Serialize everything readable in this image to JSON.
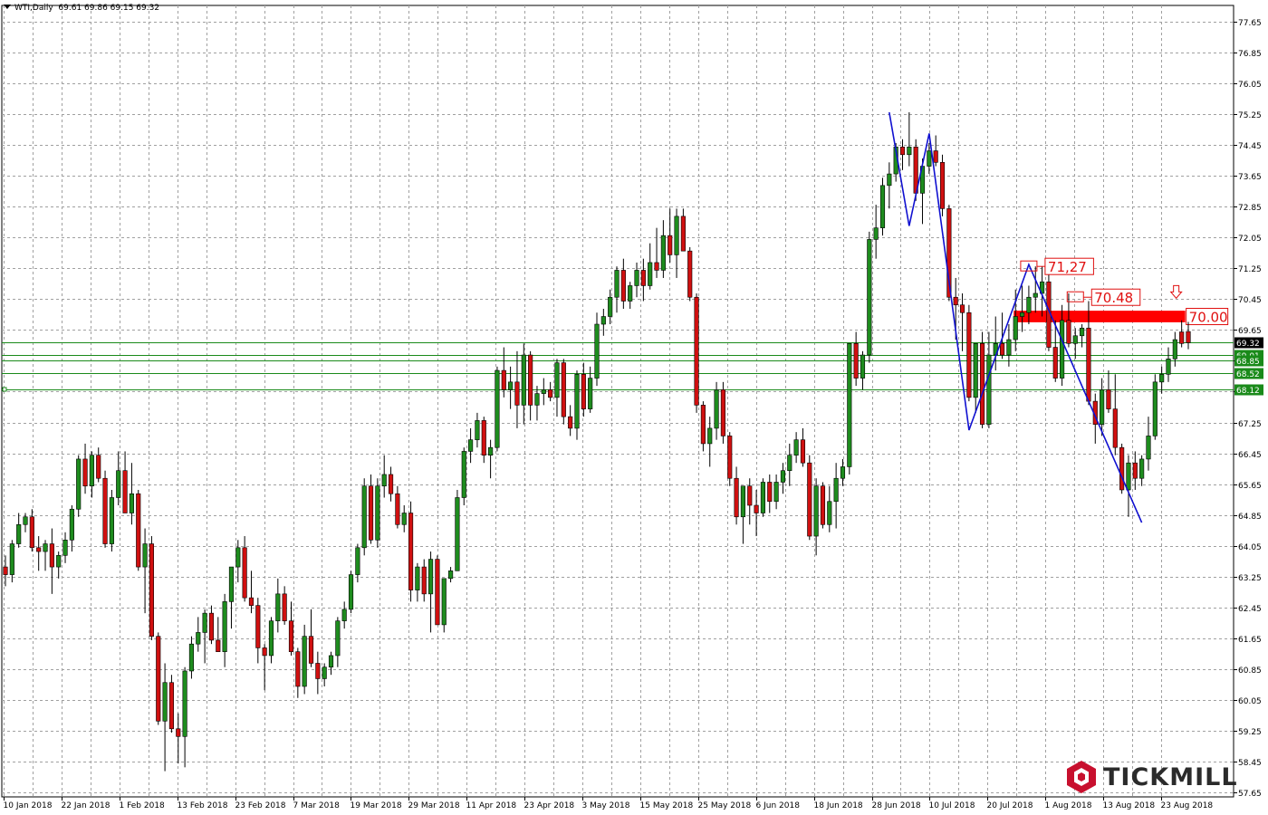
{
  "header": {
    "symbol": "WTI,Daily",
    "ohlc": "69.61 69.86 69.15 69.32"
  },
  "logo": {
    "text": "TICKMILL",
    "color": "#c8102e"
  },
  "colors": {
    "bull": "#1e8c1e",
    "bear": "#d01010",
    "grid": "#a0a0a0",
    "pattern": "#1010d0",
    "level": "#1a8a1a",
    "resistance": "#ff0000",
    "annotation": "#e01010"
  },
  "annotations": {
    "peak1": "71,27",
    "peak2": "70.48",
    "zone": "70.00"
  },
  "chart_data": {
    "type": "candlestick",
    "symbol": "WTI",
    "timeframe": "Daily",
    "ylim": [
      57.65,
      77.65
    ],
    "y_ticks": [
      "77.65",
      "76.85",
      "76.05",
      "75.25",
      "74.45",
      "73.65",
      "72.85",
      "72.05",
      "71.25",
      "70.45",
      "69.65",
      "68.85",
      "68.05",
      "67.25",
      "66.45",
      "65.65",
      "64.85",
      "64.05",
      "63.25",
      "62.45",
      "61.65",
      "60.85",
      "60.05",
      "59.25",
      "58.45",
      "57.65"
    ],
    "x_ticks": [
      "10 Jan 2018",
      "22 Jan 2018",
      "1 Feb 2018",
      "13 Feb 2018",
      "23 Feb 2018",
      "7 Mar 2018",
      "19 Mar 2018",
      "29 Mar 2018",
      "11 Apr 2018",
      "23 Apr 2018",
      "3 May 2018",
      "15 May 2018",
      "25 May 2018",
      "6 Jun 2018",
      "18 Jun 2018",
      "28 Jun 2018",
      "10 Jul 2018",
      "20 Jul 2018",
      "1 Aug 2018",
      "13 Aug 2018",
      "23 Aug 2018"
    ],
    "horizontal_levels": [
      {
        "value": 69.32,
        "label": "69.32",
        "kind": "price"
      },
      {
        "value": 69.01,
        "label": "69.01",
        "kind": "level"
      },
      {
        "value": 68.85,
        "label": "68.85",
        "kind": "level"
      },
      {
        "value": 68.52,
        "label": "68.52",
        "kind": "level"
      },
      {
        "value": 68.12,
        "label": "68.12",
        "kind": "level"
      }
    ],
    "resistance_zone": {
      "from": 69.85,
      "to": 70.15,
      "label": "70.00"
    },
    "pattern_points": [
      {
        "x": "28 Jun 2018",
        "y": 75.3
      },
      {
        "x": "3 Jul 2018",
        "y": 72.35
      },
      {
        "x": "6 Jul 2018",
        "y": 74.75
      },
      {
        "x": "16 Jul 2018",
        "y": 67.05
      },
      {
        "x": "27 Jul 2018",
        "y": 71.35
      },
      {
        "x": "16 Aug 2018",
        "y": 64.65
      }
    ],
    "candles": [
      [
        63.5,
        63.8,
        63.0,
        63.3
      ],
      [
        63.3,
        64.2,
        63.1,
        64.1
      ],
      [
        64.1,
        64.9,
        64.0,
        64.6
      ],
      [
        64.6,
        64.9,
        64.4,
        64.8
      ],
      [
        64.8,
        65.0,
        63.9,
        64.0
      ],
      [
        64.0,
        64.3,
        63.4,
        63.9
      ],
      [
        63.9,
        64.2,
        63.4,
        64.1
      ],
      [
        64.1,
        64.5,
        62.8,
        63.5
      ],
      [
        63.5,
        63.9,
        63.2,
        63.8
      ],
      [
        63.8,
        64.4,
        63.6,
        64.2
      ],
      [
        64.2,
        65.1,
        63.9,
        65.0
      ],
      [
        65.0,
        66.4,
        64.8,
        66.3
      ],
      [
        66.3,
        66.7,
        65.4,
        65.6
      ],
      [
        65.6,
        66.5,
        65.3,
        66.4
      ],
      [
        66.4,
        66.6,
        65.7,
        65.8
      ],
      [
        65.8,
        66.0,
        64.0,
        64.1
      ],
      [
        64.1,
        65.5,
        63.9,
        65.3
      ],
      [
        65.3,
        66.5,
        65.1,
        66.0
      ],
      [
        66.0,
        66.5,
        64.9,
        64.9
      ],
      [
        64.9,
        66.2,
        64.6,
        65.4
      ],
      [
        65.4,
        65.5,
        63.4,
        63.5
      ],
      [
        63.5,
        64.5,
        62.3,
        64.1
      ],
      [
        64.1,
        64.3,
        61.6,
        61.7
      ],
      [
        61.7,
        61.8,
        59.4,
        59.5
      ],
      [
        59.5,
        61.0,
        58.2,
        60.5
      ],
      [
        60.5,
        60.7,
        59.2,
        59.3
      ],
      [
        59.3,
        59.7,
        58.4,
        59.1
      ],
      [
        59.1,
        60.9,
        58.3,
        60.8
      ],
      [
        60.8,
        61.7,
        60.6,
        61.5
      ],
      [
        61.5,
        62.2,
        61.3,
        61.8
      ],
      [
        61.8,
        62.4,
        61.0,
        62.3
      ],
      [
        62.3,
        62.5,
        61.5,
        61.6
      ],
      [
        61.6,
        62.2,
        61.3,
        61.3
      ],
      [
        61.3,
        62.8,
        60.9,
        62.6
      ],
      [
        62.6,
        63.4,
        61.9,
        63.5
      ],
      [
        63.5,
        64.2,
        63.1,
        64.0
      ],
      [
        64.0,
        64.3,
        62.6,
        62.7
      ],
      [
        62.7,
        63.4,
        62.3,
        62.5
      ],
      [
        62.5,
        62.7,
        61.0,
        61.4
      ],
      [
        61.4,
        61.5,
        60.3,
        61.2
      ],
      [
        61.2,
        62.2,
        61.0,
        62.1
      ],
      [
        62.1,
        63.2,
        61.8,
        62.8
      ],
      [
        62.8,
        63.0,
        62.0,
        62.1
      ],
      [
        62.1,
        62.6,
        61.2,
        61.3
      ],
      [
        61.3,
        61.4,
        60.1,
        60.4
      ],
      [
        60.4,
        62.0,
        60.2,
        61.7
      ],
      [
        61.7,
        62.4,
        60.9,
        61.0
      ],
      [
        61.0,
        61.3,
        60.2,
        60.6
      ],
      [
        60.6,
        61.0,
        60.4,
        60.9
      ],
      [
        60.9,
        61.3,
        60.7,
        61.2
      ],
      [
        61.2,
        62.2,
        60.9,
        62.1
      ],
      [
        62.1,
        62.6,
        61.9,
        62.4
      ],
      [
        62.4,
        63.4,
        62.3,
        63.3
      ],
      [
        63.3,
        64.1,
        63.1,
        64.0
      ],
      [
        64.0,
        65.8,
        63.8,
        65.6
      ],
      [
        65.6,
        65.9,
        64.1,
        64.2
      ],
      [
        64.2,
        65.8,
        64.0,
        65.6
      ],
      [
        65.6,
        66.4,
        65.3,
        65.9
      ],
      [
        65.9,
        66.1,
        65.2,
        65.4
      ],
      [
        65.4,
        65.6,
        64.5,
        64.6
      ],
      [
        64.6,
        65.1,
        64.4,
        64.9
      ],
      [
        64.9,
        65.2,
        62.6,
        62.9
      ],
      [
        62.9,
        63.6,
        62.6,
        63.5
      ],
      [
        63.5,
        63.7,
        62.6,
        62.8
      ],
      [
        62.8,
        63.9,
        61.8,
        63.7
      ],
      [
        63.7,
        63.8,
        62.1,
        62.0
      ],
      [
        62.0,
        63.2,
        61.8,
        63.2
      ],
      [
        63.2,
        63.5,
        63.1,
        63.4
      ],
      [
        63.4,
        65.5,
        63.4,
        65.3
      ],
      [
        65.3,
        66.6,
        65.1,
        66.5
      ],
      [
        66.5,
        67.1,
        66.2,
        66.8
      ],
      [
        66.8,
        67.5,
        66.6,
        67.3
      ],
      [
        67.3,
        67.4,
        66.2,
        66.4
      ],
      [
        66.4,
        66.8,
        65.8,
        66.6
      ],
      [
        66.6,
        68.7,
        66.5,
        68.6
      ],
      [
        68.6,
        69.2,
        67.9,
        68.1
      ],
      [
        68.1,
        68.7,
        67.6,
        68.3
      ],
      [
        68.3,
        69.1,
        67.1,
        67.7
      ],
      [
        67.7,
        69.3,
        67.2,
        69.0
      ],
      [
        69.0,
        69.1,
        67.3,
        67.7
      ],
      [
        67.7,
        68.2,
        67.3,
        68.0
      ],
      [
        68.0,
        68.4,
        67.7,
        68.1
      ],
      [
        68.1,
        68.3,
        67.8,
        67.9
      ],
      [
        67.9,
        68.9,
        67.4,
        68.8
      ],
      [
        68.8,
        68.9,
        67.2,
        67.4
      ],
      [
        67.4,
        67.7,
        66.9,
        67.1
      ],
      [
        67.1,
        68.6,
        66.8,
        68.5
      ],
      [
        68.5,
        68.8,
        67.4,
        67.6
      ],
      [
        67.6,
        68.7,
        67.5,
        68.4
      ],
      [
        68.4,
        70.1,
        68.2,
        69.8
      ],
      [
        69.8,
        70.2,
        69.5,
        70.0
      ],
      [
        70.0,
        70.7,
        69.8,
        70.5
      ],
      [
        70.5,
        71.3,
        70.1,
        71.2
      ],
      [
        71.2,
        71.5,
        70.2,
        70.4
      ],
      [
        70.4,
        70.9,
        70.2,
        70.8
      ],
      [
        70.8,
        71.4,
        70.5,
        71.2
      ],
      [
        71.2,
        71.5,
        70.4,
        70.8
      ],
      [
        70.8,
        71.9,
        70.7,
        71.4
      ],
      [
        71.4,
        72.3,
        71.0,
        71.2
      ],
      [
        71.2,
        72.5,
        71.0,
        72.1
      ],
      [
        72.1,
        72.8,
        71.4,
        71.6
      ],
      [
        71.6,
        72.8,
        71.0,
        72.6
      ],
      [
        72.6,
        72.8,
        71.7,
        71.7
      ],
      [
        71.7,
        71.8,
        70.4,
        70.5
      ],
      [
        70.5,
        70.6,
        67.5,
        67.7
      ],
      [
        67.7,
        67.8,
        66.5,
        66.7
      ],
      [
        66.7,
        67.4,
        66.1,
        67.1
      ],
      [
        67.1,
        68.3,
        66.8,
        68.1
      ],
      [
        68.1,
        68.3,
        66.7,
        66.9
      ],
      [
        66.9,
        67.0,
        65.6,
        65.8
      ],
      [
        65.8,
        66.1,
        64.6,
        64.8
      ],
      [
        64.8,
        65.6,
        64.1,
        65.6
      ],
      [
        65.6,
        65.8,
        64.6,
        65.1
      ],
      [
        65.1,
        65.5,
        64.3,
        64.9
      ],
      [
        64.9,
        65.8,
        64.8,
        65.7
      ],
      [
        65.7,
        65.9,
        64.9,
        65.2
      ],
      [
        65.2,
        65.9,
        65.0,
        65.7
      ],
      [
        65.7,
        66.2,
        65.4,
        66.0
      ],
      [
        66.0,
        66.7,
        65.6,
        66.4
      ],
      [
        66.4,
        67.0,
        66.2,
        66.8
      ],
      [
        66.8,
        67.1,
        66.1,
        66.2
      ],
      [
        66.2,
        66.4,
        64.2,
        64.3
      ],
      [
        64.3,
        65.8,
        63.8,
        65.6
      ],
      [
        65.6,
        65.7,
        64.5,
        64.6
      ],
      [
        64.6,
        65.6,
        64.4,
        65.2
      ],
      [
        65.2,
        66.2,
        64.5,
        65.8
      ],
      [
        65.8,
        66.3,
        65.6,
        66.1
      ],
      [
        66.1,
        69.3,
        65.9,
        69.3
      ],
      [
        69.3,
        69.6,
        68.2,
        68.4
      ],
      [
        68.4,
        69.1,
        68.1,
        69.0
      ],
      [
        69.0,
        72.2,
        68.8,
        72.0
      ],
      [
        72.0,
        72.9,
        71.5,
        72.3
      ],
      [
        72.3,
        73.6,
        72.1,
        73.4
      ],
      [
        73.4,
        74.0,
        72.8,
        73.7
      ],
      [
        73.7,
        74.5,
        73.5,
        74.4
      ],
      [
        74.4,
        74.6,
        73.8,
        74.2
      ],
      [
        74.2,
        75.3,
        73.9,
        74.4
      ],
      [
        74.4,
        74.6,
        73.0,
        73.2
      ],
      [
        73.2,
        74.1,
        72.4,
        73.9
      ],
      [
        73.9,
        74.5,
        73.7,
        74.3
      ],
      [
        74.3,
        74.7,
        73.9,
        74.0
      ],
      [
        74.0,
        74.2,
        72.6,
        72.8
      ],
      [
        72.8,
        72.9,
        70.4,
        70.5
      ],
      [
        70.5,
        71.0,
        69.4,
        70.3
      ],
      [
        70.3,
        70.6,
        69.1,
        70.1
      ],
      [
        70.1,
        70.3,
        67.8,
        67.9
      ],
      [
        67.9,
        69.3,
        67.5,
        69.3
      ],
      [
        69.3,
        69.6,
        67.1,
        67.2
      ],
      [
        67.2,
        69.6,
        67.1,
        69.0
      ],
      [
        69.0,
        70.0,
        68.6,
        69.3
      ],
      [
        69.3,
        70.1,
        68.9,
        69.0
      ],
      [
        69.0,
        69.8,
        68.7,
        69.4
      ],
      [
        69.4,
        70.7,
        69.1,
        70.0
      ],
      [
        70.0,
        70.8,
        69.6,
        70.1
      ],
      [
        70.1,
        70.8,
        69.8,
        70.5
      ],
      [
        70.5,
        71.3,
        70.1,
        70.6
      ],
      [
        70.6,
        71.3,
        70.0,
        70.9
      ],
      [
        70.9,
        71.1,
        69.1,
        69.2
      ],
      [
        69.2,
        69.9,
        68.3,
        68.4
      ],
      [
        68.4,
        70.3,
        68.2,
        69.9
      ],
      [
        69.9,
        70.6,
        69.2,
        69.3
      ],
      [
        69.3,
        69.7,
        68.9,
        69.5
      ],
      [
        69.5,
        69.8,
        69.2,
        69.7
      ],
      [
        69.7,
        70.4,
        67.7,
        67.8
      ],
      [
        67.8,
        68.0,
        66.7,
        67.2
      ],
      [
        67.2,
        68.4,
        66.9,
        68.1
      ],
      [
        68.1,
        68.6,
        67.5,
        67.6
      ],
      [
        67.6,
        68.5,
        66.4,
        66.6
      ],
      [
        66.6,
        66.7,
        65.4,
        65.5
      ],
      [
        65.5,
        66.4,
        64.8,
        66.2
      ],
      [
        66.2,
        66.5,
        65.5,
        65.8
      ],
      [
        65.8,
        66.4,
        65.6,
        66.3
      ],
      [
        66.3,
        67.4,
        66.0,
        66.9
      ],
      [
        66.9,
        68.5,
        66.8,
        68.3
      ],
      [
        68.3,
        68.7,
        68.0,
        68.5
      ],
      [
        68.5,
        69.2,
        68.3,
        68.9
      ],
      [
        68.9,
        69.6,
        68.7,
        69.4
      ],
      [
        69.6,
        69.9,
        69.2,
        69.3
      ],
      [
        69.61,
        69.86,
        69.15,
        69.32
      ]
    ]
  }
}
